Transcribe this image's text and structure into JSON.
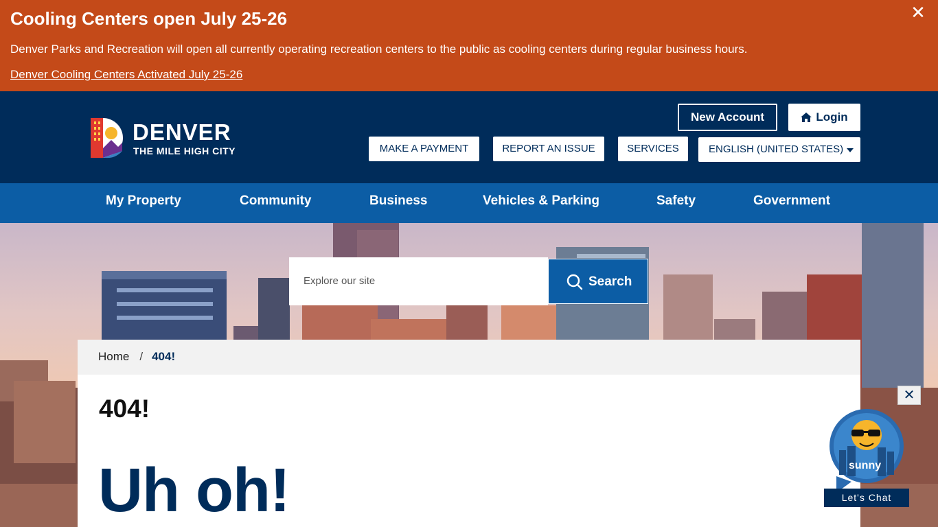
{
  "alert": {
    "title": "Cooling Centers open July 25-26",
    "text": "Denver Parks and Recreation will open all currently operating recreation centers to the public as cooling centers during regular business hours.",
    "link": "Denver Cooling Centers Activated July 25-26",
    "close": "✕"
  },
  "header": {
    "logo_word": "DENVER",
    "logo_tag": "THE MILE HIGH CITY",
    "new_account": "New Account",
    "login": "Login",
    "make_payment": "MAKE A PAYMENT",
    "report_issue": "REPORT AN ISSUE",
    "services": "SERVICES",
    "language": "ENGLISH (UNITED STATES)"
  },
  "nav": {
    "items": [
      {
        "label": "My Property"
      },
      {
        "label": "Community"
      },
      {
        "label": "Business"
      },
      {
        "label": "Vehicles & Parking"
      },
      {
        "label": "Safety"
      },
      {
        "label": "Government"
      }
    ]
  },
  "search": {
    "placeholder": "Explore our site",
    "button": "Search"
  },
  "breadcrumb": {
    "home": "Home",
    "separator": "/",
    "current": "404!"
  },
  "content": {
    "heading": "404!",
    "message": "Uh oh!"
  },
  "chat": {
    "name": "sunny",
    "label": "Let's Chat",
    "close": "✕"
  },
  "colors": {
    "alert": "#c44a19",
    "header": "#002c5a",
    "nav": "#0c5da5"
  }
}
